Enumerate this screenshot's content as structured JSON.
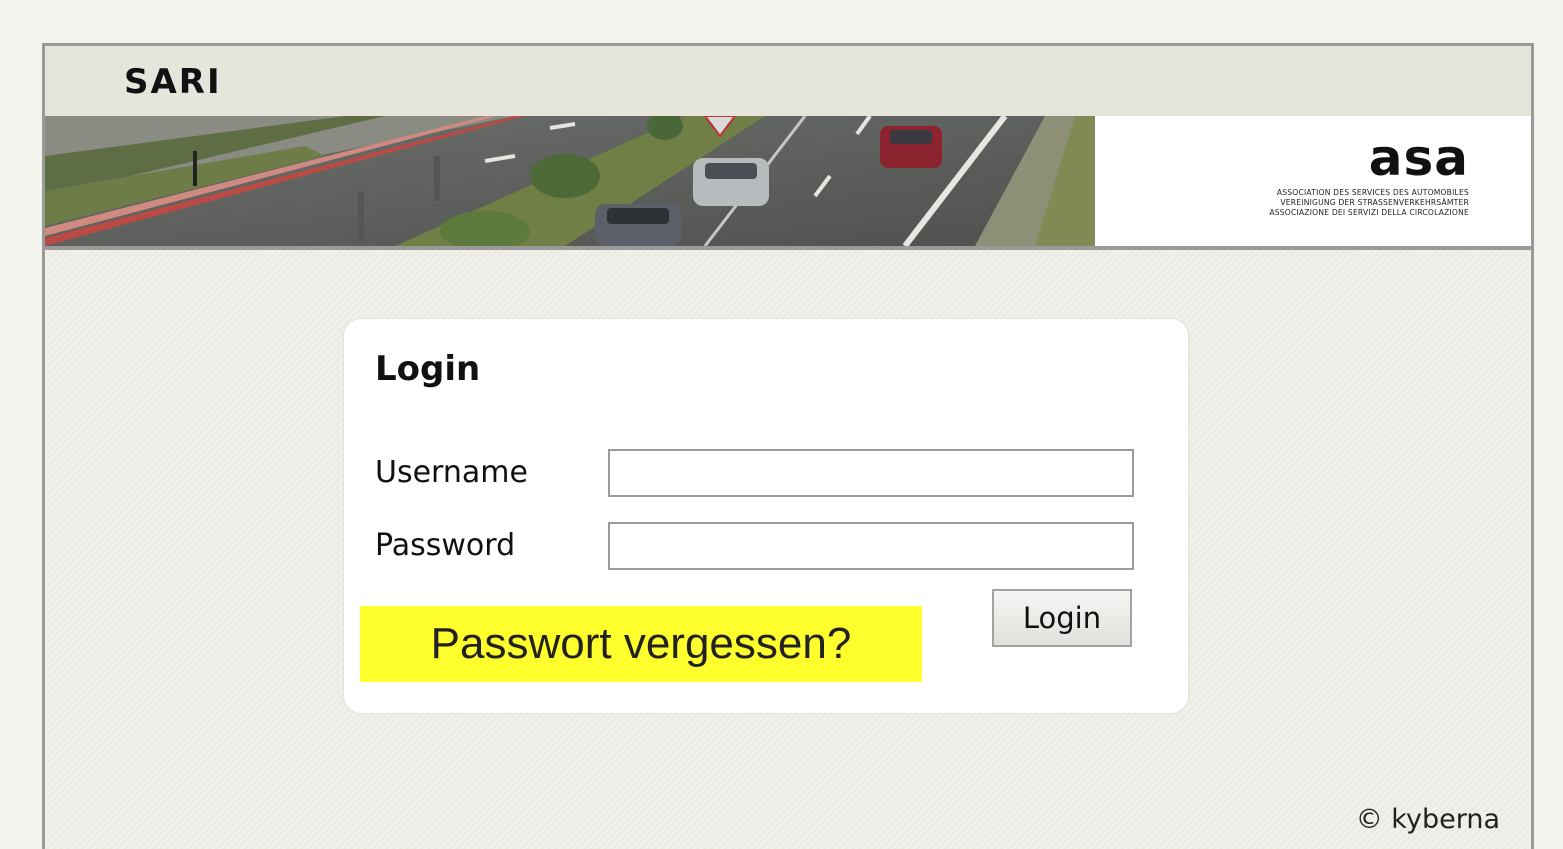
{
  "app": {
    "title": "SARI"
  },
  "banner": {
    "logo_word": "asa",
    "logo_lines": [
      "ASSOCIATION DES SERVICES DES AUTOMOBILES",
      "VEREINIGUNG DER STRASSENVERKEHRSÄMTER",
      "ASSOCIAZIONE DEI SERVIZI DELLA CIRCOLAZIONE"
    ],
    "photo": "highway-traffic-photo"
  },
  "login": {
    "heading": "Login",
    "username_label": "Username",
    "username_value": "",
    "password_label": "Password",
    "password_value": "",
    "forgot_link": "Passwort vergessen?",
    "submit_label": "Login"
  },
  "footer": {
    "copyright": "© kyberna"
  },
  "colors": {
    "highlight": "#ffff2e",
    "frame_border": "#9a9a98",
    "titlebar": "#e6e5dc"
  }
}
